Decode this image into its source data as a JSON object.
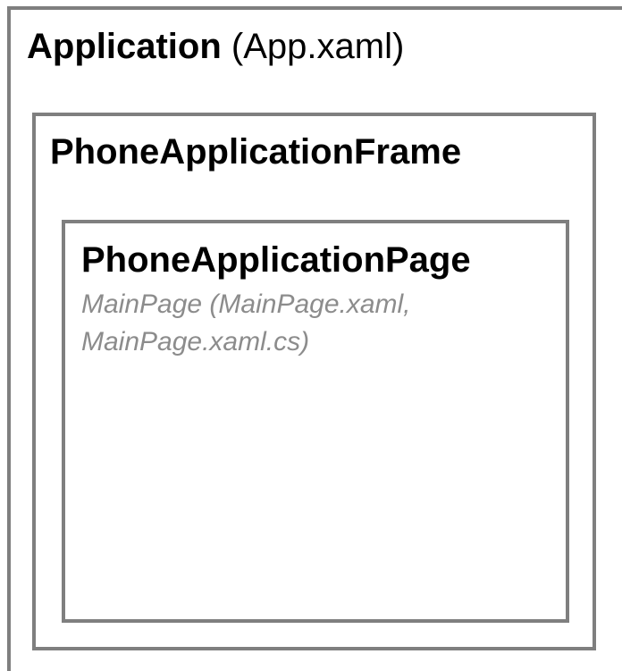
{
  "application": {
    "name": "Application",
    "file": "(App.xaml)"
  },
  "frame": {
    "name": "PhoneApplicationFrame"
  },
  "page": {
    "name": "PhoneApplicationPage",
    "subtitle_line1": "MainPage (MainPage.xaml,",
    "subtitle_line2": "MainPage.xaml.cs)"
  },
  "colors": {
    "border": "#7f7f7f",
    "subtitle": "#8c8c8c",
    "text": "#000000"
  }
}
